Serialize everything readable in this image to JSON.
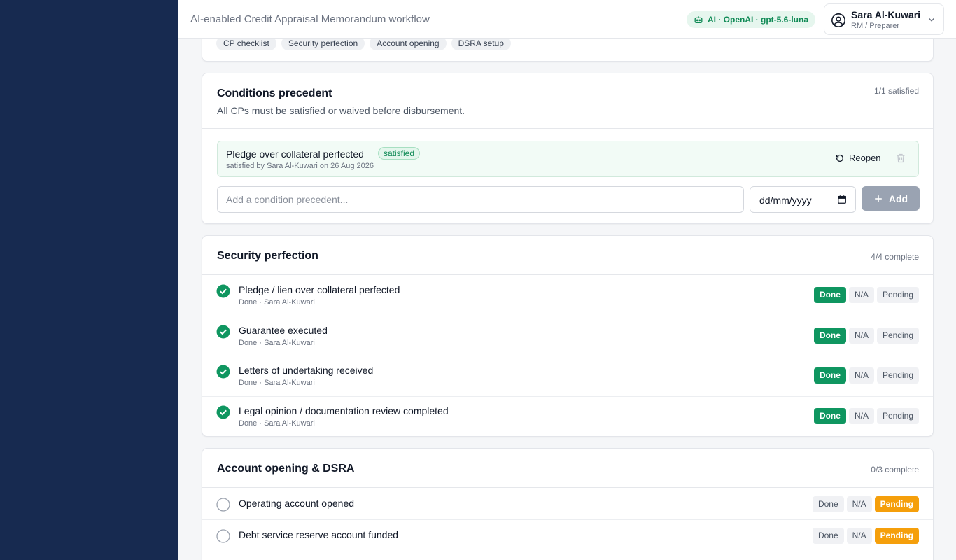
{
  "header": {
    "app_title": "AI-enabled Credit Appraisal Memorandum workflow",
    "ai_badge": "AI · OpenAI · gpt-5.6-luna",
    "user_name": "Sara Al-Kuwari",
    "user_role": "RM / Preparer"
  },
  "top_chips": [
    "CP checklist",
    "Security perfection",
    "Account opening",
    "DSRA setup"
  ],
  "conditions": {
    "title": "Conditions precedent",
    "subtitle": "All CPs must be satisfied or waived before disbursement.",
    "meta": "1/1 satisfied",
    "item": {
      "title": "Pledge over collateral perfected",
      "status": "satisfied",
      "by": "satisfied by Sara Al-Kuwari on 26 Aug 2026",
      "reopen_label": "Reopen"
    },
    "input_placeholder": "Add a condition precedent...",
    "date_placeholder": "dd/mm/yyyy",
    "add_label": "Add"
  },
  "security": {
    "title": "Security perfection",
    "meta": "4/4 complete",
    "items": [
      {
        "title": "Pledge / lien over collateral perfected",
        "sub": "Done · Sara Al-Kuwari"
      },
      {
        "title": "Guarantee executed",
        "sub": "Done · Sara Al-Kuwari"
      },
      {
        "title": "Letters of undertaking received",
        "sub": "Done · Sara Al-Kuwari"
      },
      {
        "title": "Legal opinion / documentation review completed",
        "sub": "Done · Sara Al-Kuwari"
      }
    ]
  },
  "accounts": {
    "title": "Account opening & DSRA",
    "meta": "0/3 complete",
    "items": [
      {
        "title": "Operating account opened"
      },
      {
        "title": "Debt service reserve account funded"
      }
    ]
  },
  "status_labels": {
    "done": "Done",
    "na": "N/A",
    "pending": "Pending"
  },
  "colors": {
    "sidebar": "#172a50",
    "done": "#0f9660",
    "pending": "#f59f0b",
    "ai_badge": "#0f8a55"
  }
}
